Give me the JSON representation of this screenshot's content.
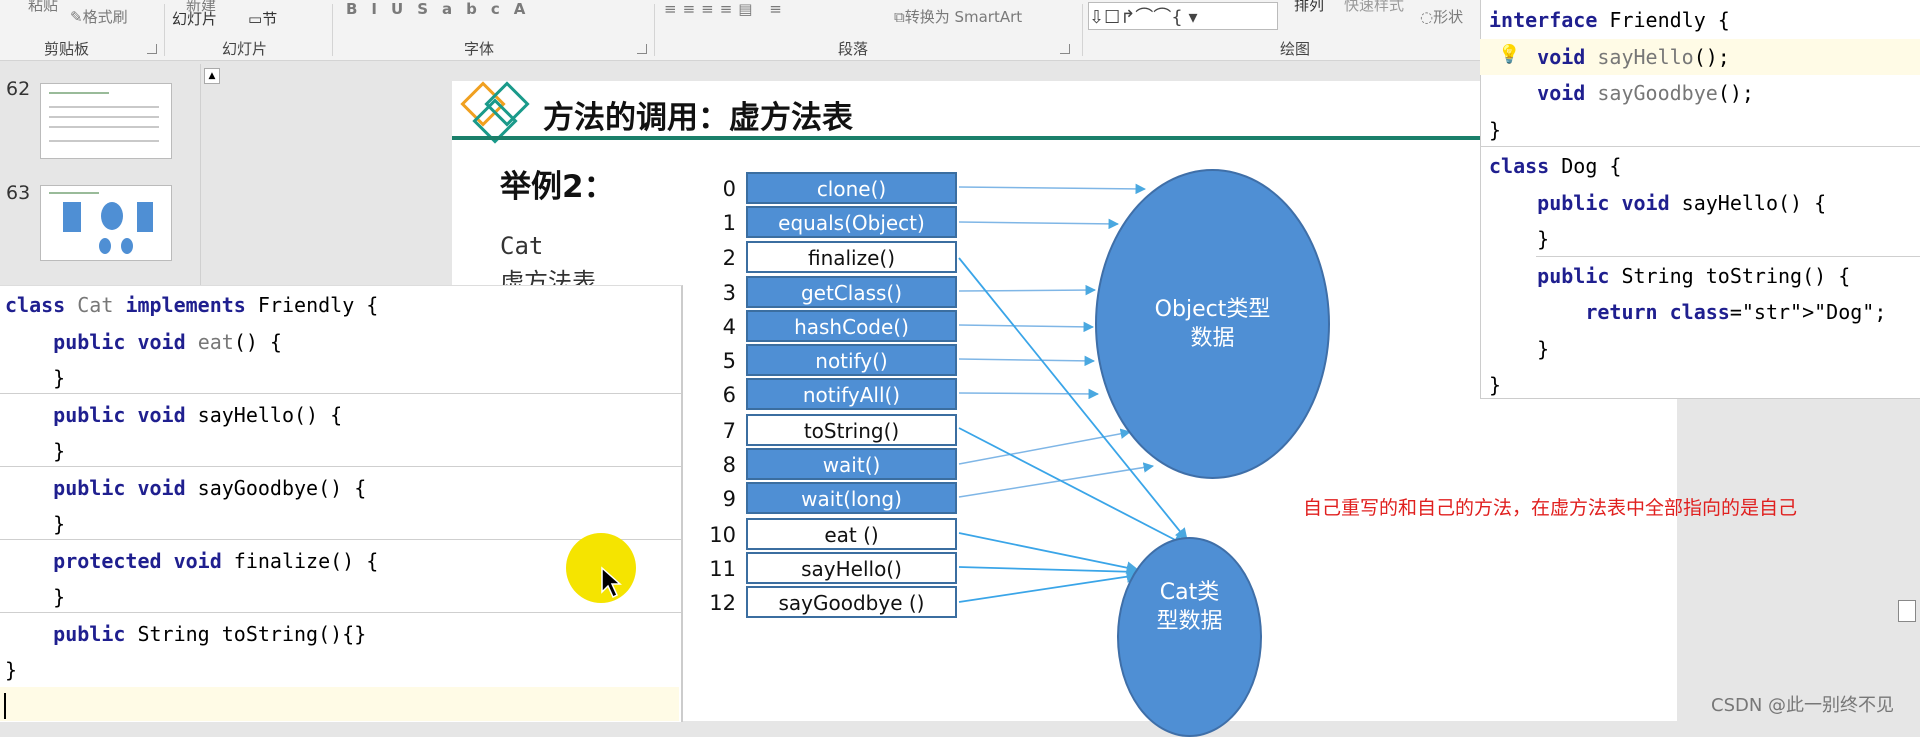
{
  "ribbon": {
    "groups": [
      {
        "label": "剪贴板"
      },
      {
        "label": "幻灯片"
      },
      {
        "label": "字体"
      },
      {
        "label": "段落"
      },
      {
        "label": "绘图"
      }
    ],
    "format_painter_label": "格式刷",
    "new_slide_label": "新建",
    "slide_btn_label": "幻灯片",
    "section_label": "节",
    "smartart_label": "转换为 SmartArt",
    "paste_label": "粘贴",
    "arrange_label": "排列",
    "quickstyle_label": "快速样式",
    "shape_label": "形状"
  },
  "thumbnails": [
    {
      "number": "62"
    },
    {
      "number": "63"
    }
  ],
  "slide": {
    "title": "方法的调用：虚方法表",
    "example_label": "举例2：",
    "cat_label": "Cat",
    "cat_sub_label": "虚方法表",
    "table": {
      "indices": [
        "0",
        "1",
        "2",
        "3",
        "4",
        "5",
        "6",
        "7",
        "8",
        "9",
        "10",
        "11",
        "12"
      ],
      "methods": [
        "clone()",
        "equals(Object)",
        "finalize()",
        "getClass()",
        "hashCode()",
        "notify()",
        "notifyAll()",
        "toString()",
        "wait()",
        "wait(long)",
        "eat ()",
        "sayHello()",
        "sayGoodbye ()"
      ],
      "highlighted": [
        true,
        true,
        false,
        true,
        true,
        true,
        true,
        false,
        true,
        true,
        false,
        false,
        false
      ]
    },
    "object_ellipse_label": "Object类型\n数据",
    "cat_ellipse_label": "Cat类\n型数据",
    "note": "自己重写的和自己的方法，在虚方法表中全部指向的是自己",
    "colors": {
      "cell_blue": "#4f8fd4",
      "title_bar": "#1a7f6a",
      "note": "#e0201f"
    }
  },
  "cat_code": {
    "lines": [
      "class Cat implements Friendly {",
      "    public void eat() {",
      "    }",
      "    public void sayHello() {",
      "    }",
      "    public void sayGoodbye() {",
      "    }",
      "    protected void finalize() {",
      "    }",
      "    public String toString(){}",
      "}"
    ]
  },
  "dog_code": {
    "lines": [
      "interface Friendly {",
      "    void sayHello();",
      "    void sayGoodbye();",
      "}",
      "class Dog {",
      "    public void sayHello() {",
      "    }",
      "    public String toString() {",
      "        return \"Dog\";",
      "    }",
      "}"
    ]
  },
  "watermark": "CSDN @此一别终不见"
}
